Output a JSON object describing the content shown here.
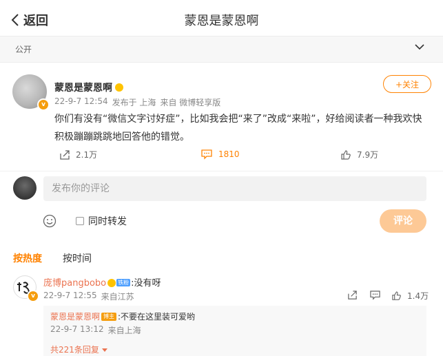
{
  "header": {
    "back_label": "返回",
    "title": "蒙恩是蒙恩啊"
  },
  "visibility": {
    "label": "公开"
  },
  "post": {
    "username": "蒙恩是蒙恩啊",
    "time": "22-9-7 12:54",
    "location": "发布于 上海",
    "source": "来自 微博轻享版",
    "follow_label": "+关注",
    "text": "你们有没有“微信文字讨好症”，比如我会把“来了”改成“来啦”，好给阅读者一种我欢快积极蹦蹦跳跳地回答他的错觉。",
    "reposts": "2.1万",
    "comments": "1810",
    "likes": "7.9万"
  },
  "composer": {
    "placeholder": "发布你的评论",
    "repost_label": "同时转发",
    "submit_label": "评论"
  },
  "sort_tabs": {
    "hot": "按热度",
    "time": "按时间"
  },
  "comment": {
    "username": "庞博pangbobo",
    "fans_badge": "铁粉",
    "text": ":没有呀",
    "time": "22-9-7 12:55",
    "location": "来自江苏",
    "likes": "1.4万",
    "reply": {
      "username": "蒙恩是蒙恩啊",
      "badge": "博主",
      "text": ":不要在这里装可爱哟",
      "time": "22-9-7 13:12",
      "location": "来自上海"
    },
    "more_replies": "共221条回复"
  },
  "colors": {
    "accent": "#ff8200",
    "name_link": "#eb7350",
    "badge": "#f59d0e"
  }
}
